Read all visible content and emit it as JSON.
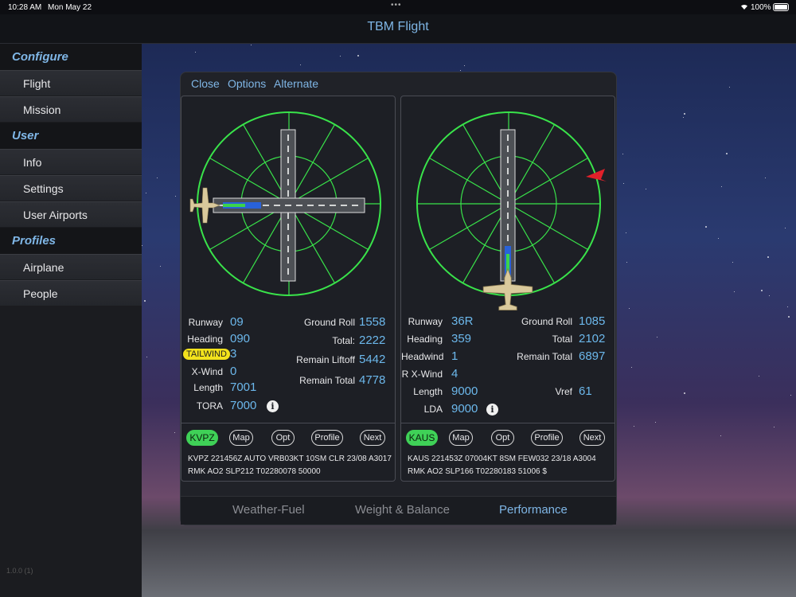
{
  "status": {
    "time": "10:28 AM",
    "date": "Mon May 22",
    "dots": "•••",
    "battery": "100%"
  },
  "app_title": "TBM Flight",
  "sidebar": {
    "sections": [
      {
        "title": "Configure",
        "items": [
          "Flight",
          "Mission"
        ]
      },
      {
        "title": "User",
        "items": [
          "Info",
          "Settings",
          "User Airports"
        ]
      },
      {
        "title": "Profiles",
        "items": [
          "Airplane",
          "People"
        ]
      }
    ],
    "version": "1.0.0 (1)"
  },
  "toolbar": {
    "close": "Close",
    "options": "Options",
    "alternate": "Alternate"
  },
  "departure": {
    "labels": {
      "runway": "Runway",
      "heading": "Heading",
      "wind": "TAILWIND",
      "xwind": "X-Wind",
      "length": "Length",
      "tora": "TORA",
      "ground_roll": "Ground Roll",
      "total": "Total:",
      "remain_liftoff": "Remain Liftoff",
      "remain_total": "Remain Total"
    },
    "values": {
      "runway": "09",
      "heading": "090",
      "wind": "3",
      "xwind": "0",
      "length": "7001",
      "tora": "7000",
      "ground_roll": "1558",
      "total": "2222",
      "remain_liftoff": "5442",
      "remain_total": "4778"
    },
    "airport": "KVPZ",
    "buttons": [
      "Map",
      "Opt",
      "Profile",
      "Next"
    ],
    "metar": "KVPZ 221456Z AUTO VRB03KT 10SM CLR 23/08 A3017 RMK AO2 SLP212 T02280078 50000"
  },
  "arrival": {
    "labels": {
      "runway": "Runway",
      "heading": "Heading",
      "headwind": "Headwind",
      "xwind": "R X-Wind",
      "length": "Length",
      "lda": "LDA",
      "ground_roll": "Ground Roll",
      "total": "Total",
      "remain_total": "Remain Total",
      "vref": "Vref"
    },
    "values": {
      "runway": "36R",
      "heading": "359",
      "headwind": "1",
      "xwind": "4",
      "length": "9000",
      "lda": "9000",
      "ground_roll": "1085",
      "total": "2102",
      "remain_total": "6897",
      "vref": "61"
    },
    "airport": "KAUS",
    "buttons": [
      "Map",
      "Opt",
      "Profile",
      "Next"
    ],
    "metar": "KAUS 221453Z 07004KT 8SM FEW032 23/18 A3004 RMK AO2 SLP166 T02280183 51006 $"
  },
  "icons": {
    "info": "info-icon",
    "wind_arrow": "wind-arrow-icon",
    "airplane": "airplane-icon"
  },
  "colors": {
    "accent": "#7fb6e6",
    "value": "#6cb8ec",
    "rose": "#39e34a",
    "tailwind": "#f2e21c",
    "airport_pill": "#3fd157",
    "wind_arrow": "#e0202a"
  },
  "info_glyph": "i",
  "tabs": [
    "Weather-Fuel",
    "Weight & Balance",
    "Performance"
  ],
  "active_tab": "Performance"
}
